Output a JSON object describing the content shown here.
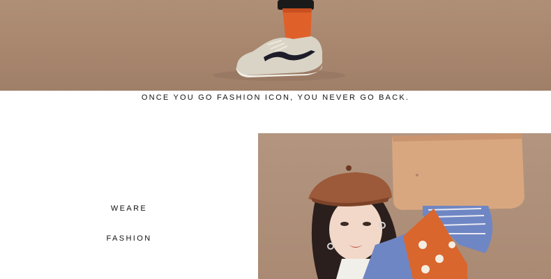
{
  "hero": {
    "image_alt": "sneaker-and-orange-sock-photo"
  },
  "tagline": "ONCE YOU GO FASHION ICON, YOU NEVER GO BACK.",
  "side_labels": {
    "line1": "WEARE",
    "line2": "FASHION"
  },
  "model_photo": {
    "image_alt": "model-with-beret-and-paper-bag-photo"
  },
  "colors": {
    "backdrop": "#a8866e",
    "sock": "#e0602a",
    "beret": "#9c5a3a",
    "paper_bag": "#d9a77f",
    "shirt_stripe": "#6f86c4",
    "vest": "#d9662d"
  }
}
